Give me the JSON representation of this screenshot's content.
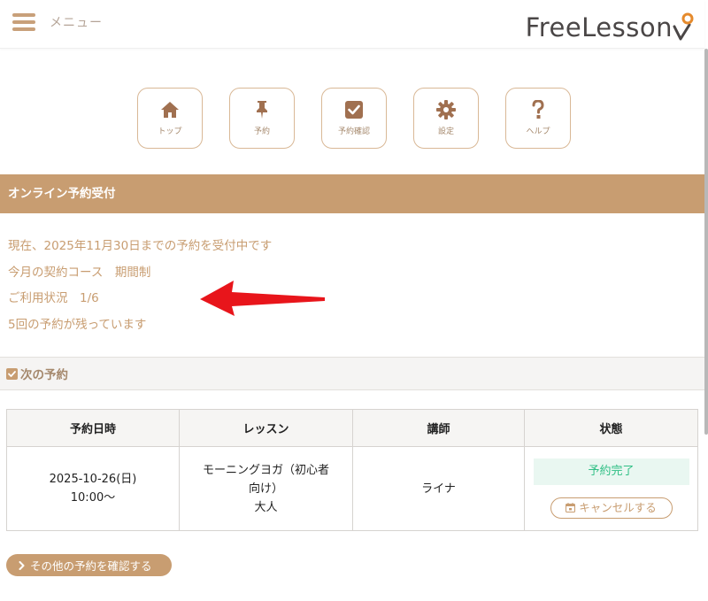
{
  "header": {
    "menu_label": "メニュー",
    "logo_text": "FreeLesson"
  },
  "nav": [
    {
      "label": "トップ",
      "icon": "home-icon"
    },
    {
      "label": "予約",
      "icon": "pin-icon"
    },
    {
      "label": "予約確認",
      "icon": "check-square-icon"
    },
    {
      "label": "設定",
      "icon": "gear-icon"
    },
    {
      "label": "ヘルプ",
      "icon": "question-icon"
    }
  ],
  "section_title": "オンライン予約受付",
  "info": {
    "line1": "現在、2025年11月30日までの予約を受付中です",
    "line2": "今月の契約コース　期間制",
    "line3": "ご利用状況　1/6",
    "line4": "5回の予約が残っています"
  },
  "next": {
    "title": "次の予約"
  },
  "table": {
    "headers": [
      "予約日時",
      "レッスン",
      "講師",
      "状態"
    ],
    "row": {
      "date": "2025-10-26(日)",
      "time": "10:00〜",
      "lesson1": "モーニングヨガ（初心者",
      "lesson2": "向け）",
      "lesson3": "大人",
      "teacher": "ライナ",
      "status": "予約完了",
      "cancel_label": "キャンセルする"
    }
  },
  "other_label": "その他の予約を確認する",
  "colors": {
    "accent": "#c89d71",
    "status_ok": "#2fbf85",
    "arrow": "#e8151b"
  }
}
